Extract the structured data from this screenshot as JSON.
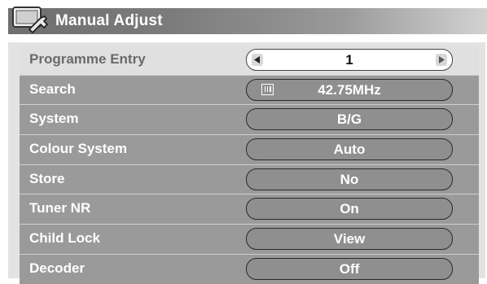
{
  "header": {
    "title": "Manual Adjust",
    "icon": "tv-wrench-icon"
  },
  "menu": {
    "items": [
      {
        "label": "Programme Entry",
        "value": "1"
      },
      {
        "label": "Search",
        "value": "42.75MHz",
        "icon": "signal-bars-icon"
      },
      {
        "label": "System",
        "value": "B/G"
      },
      {
        "label": "Colour System",
        "value": "Auto"
      },
      {
        "label": "Store",
        "value": "No"
      },
      {
        "label": "Tuner NR",
        "value": "On"
      },
      {
        "label": "Child Lock",
        "value": "View"
      },
      {
        "label": "Decoder",
        "value": "Off"
      }
    ]
  },
  "colors": {
    "row_bg": "#9a9a9a",
    "selected_row_bg": "#e0e0e0",
    "pill_bg": "#8f8f8f",
    "title_bar": "#6f6f6f"
  }
}
